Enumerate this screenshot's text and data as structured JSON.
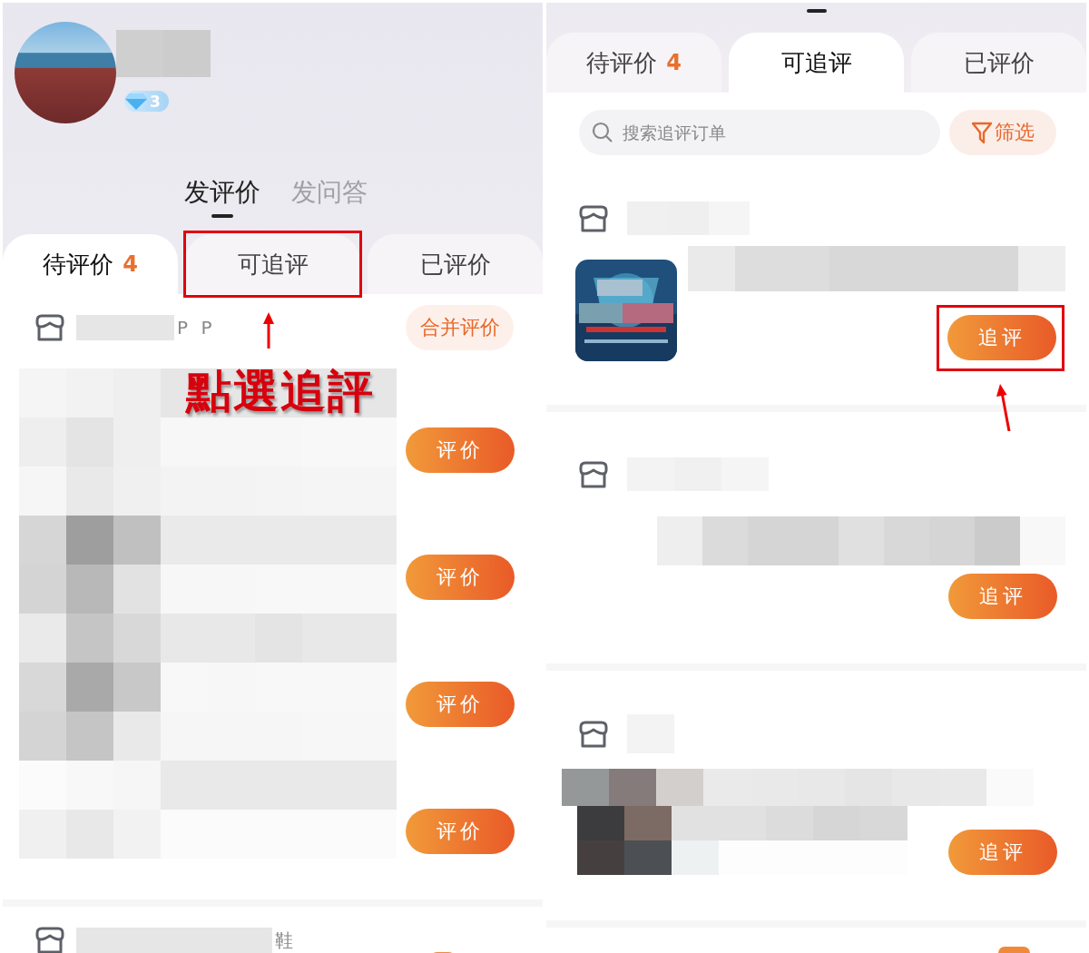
{
  "left_screen": {
    "profile": {
      "level": "3"
    },
    "mode_tabs": [
      {
        "label": "发评价",
        "selected": true
      },
      {
        "label": "发问答",
        "selected": false
      }
    ],
    "tabs": [
      {
        "label": "待评价",
        "count": "4",
        "selected": true,
        "highlighted": false
      },
      {
        "label": "可追评",
        "selected": false,
        "highlighted": true
      },
      {
        "label": "已评价",
        "selected": false,
        "highlighted": false
      }
    ],
    "annotation": "點選追評",
    "orders": [
      {
        "shop_name": "P P",
        "merge_button": "合并评价",
        "items": [
          {
            "button": "评价"
          },
          {
            "button": "评价"
          },
          {
            "button": "评价"
          },
          {
            "button": "评价"
          }
        ]
      },
      {
        "shop_name": "鞋"
      }
    ]
  },
  "right_screen": {
    "tabs": [
      {
        "label": "待评价",
        "count": "4",
        "selected": false
      },
      {
        "label": "可追评",
        "selected": true
      },
      {
        "label": "已评价",
        "selected": false
      }
    ],
    "search": {
      "placeholder": "搜索追评订单"
    },
    "filter_button": "筛选",
    "orders": [
      {
        "button": "追评",
        "highlighted": true
      },
      {
        "button": "追评",
        "highlighted": false
      },
      {
        "button": "追评",
        "highlighted": false
      }
    ]
  }
}
